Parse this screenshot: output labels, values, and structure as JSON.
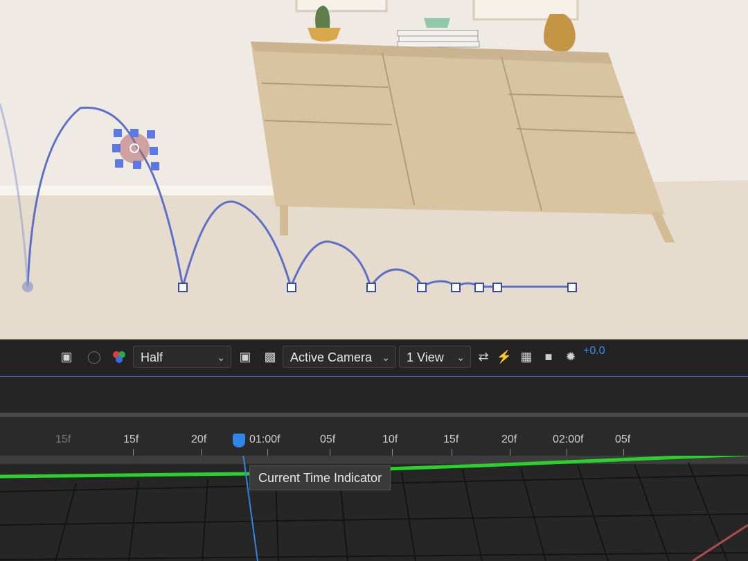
{
  "toolbar": {
    "resolution": "Half",
    "camera": "Active Camera",
    "views": "1 View",
    "exposure": "+0.0"
  },
  "timeline": {
    "ticks": [
      "15f",
      "20f",
      "01:00f",
      "05f",
      "10f",
      "15f",
      "20f",
      "02:00f",
      "05f"
    ],
    "tooltip": "Current Time Indicator"
  },
  "icons": {
    "snapshot": "camera-icon",
    "color_channel": "rgb-channel-icon",
    "region": "region-of-interest-icon",
    "transparency": "transparency-grid-icon",
    "transfer": "transfer-icon",
    "fast_preview": "fast-preview-icon",
    "timeline_toggle": "timeline-icon",
    "flowchart": "flowchart-icon",
    "reset_exposure": "exposure-icon"
  },
  "colors": {
    "accent": "#2f86e8",
    "graph_line": "#2bd12b",
    "motion_path": "#5d6fc8"
  }
}
